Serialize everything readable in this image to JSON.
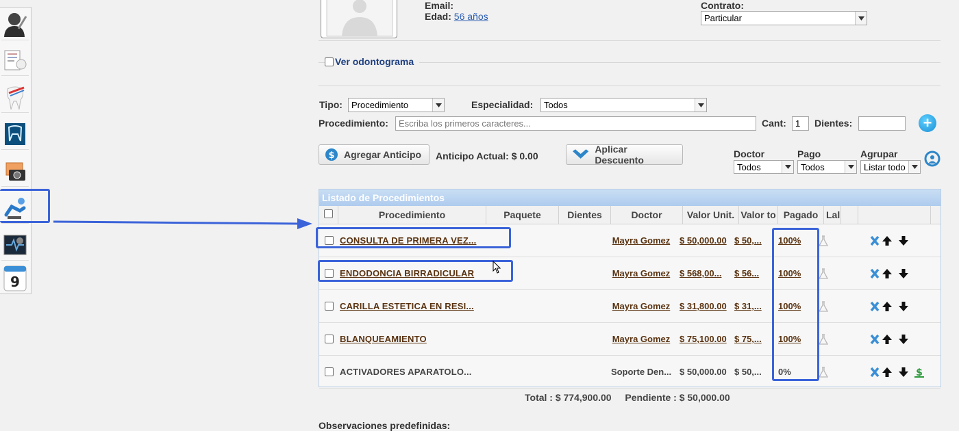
{
  "patient": {
    "email_label": "Email:",
    "age_label": "Edad:",
    "age_value": "56 años",
    "contract_label": "Contrato:",
    "contract_value": "Particular"
  },
  "odontogram": {
    "label": "Ver odontograma"
  },
  "filters": {
    "tipo_label": "Tipo:",
    "tipo_value": "Procedimiento",
    "especialidad_label": "Especialidad:",
    "especialidad_value": "Todos",
    "procedimiento_label": "Procedimiento:",
    "procedimiento_placeholder": "Escriba los primeros caracteres...",
    "cant_label": "Cant:",
    "cant_value": "1",
    "dientes_label": "Dientes:",
    "dientes_value": ""
  },
  "actions": {
    "anticipo_button": "Agregar Anticipo",
    "anticipo_actual": "Anticipo Actual: $ 0.00",
    "descuento_button": "Aplicar Descuento"
  },
  "dropdowns": {
    "doctor_label": "Doctor",
    "doctor_value": "Todos",
    "pago_label": "Pago",
    "pago_value": "Todos",
    "agrupar_label": "Agrupar",
    "agrupar_value": "Listar todo"
  },
  "table": {
    "caption": "Listado de Procedimientos",
    "headers": [
      "Procedimiento",
      "Paquete",
      "Dientes",
      "Doctor",
      "Valor Unit.",
      "Valor to",
      "Pagado",
      "Lal"
    ],
    "rows": [
      {
        "procedimiento": "CONSULTA DE PRIMERA VEZ...",
        "doctor": "Mayra Gomez",
        "valor_unit": "$ 50,000.00",
        "valor_total": "$ 50,...",
        "pagado": "100%",
        "linked": true,
        "cash": false
      },
      {
        "procedimiento": "ENDODONCIA BIRRADICULAR",
        "doctor": "Mayra Gomez",
        "valor_unit": "$ 568,00...",
        "valor_total": "$ 56...",
        "pagado": "100%",
        "linked": true,
        "cash": false
      },
      {
        "procedimiento": "CARILLA ESTETICA EN RESI...",
        "doctor": "Mayra Gomez",
        "valor_unit": "$ 31,800.00",
        "valor_total": "$ 31,...",
        "pagado": "100%",
        "linked": true,
        "cash": false
      },
      {
        "procedimiento": "BLANQUEAMIENTO",
        "doctor": "Mayra Gomez",
        "valor_unit": "$ 75,100.00",
        "valor_total": "$ 75,...",
        "pagado": "100%",
        "linked": true,
        "cash": false
      },
      {
        "procedimiento": "ACTIVADORES APARATOLO...",
        "doctor": "Soporte Den...",
        "valor_unit": "$ 50,000.00",
        "valor_total": "$ 50,...",
        "pagado": "0%",
        "linked": false,
        "cash": true
      }
    ]
  },
  "totals": {
    "total": "Total : $ 774,900.00",
    "pendiente": "Pendiente : $ 50,000.00"
  },
  "observaciones_label": "Observaciones predefinidas:",
  "colors": {
    "highlight": "#3b63d9",
    "link": "#5a3311",
    "caption": "#aecbee"
  }
}
